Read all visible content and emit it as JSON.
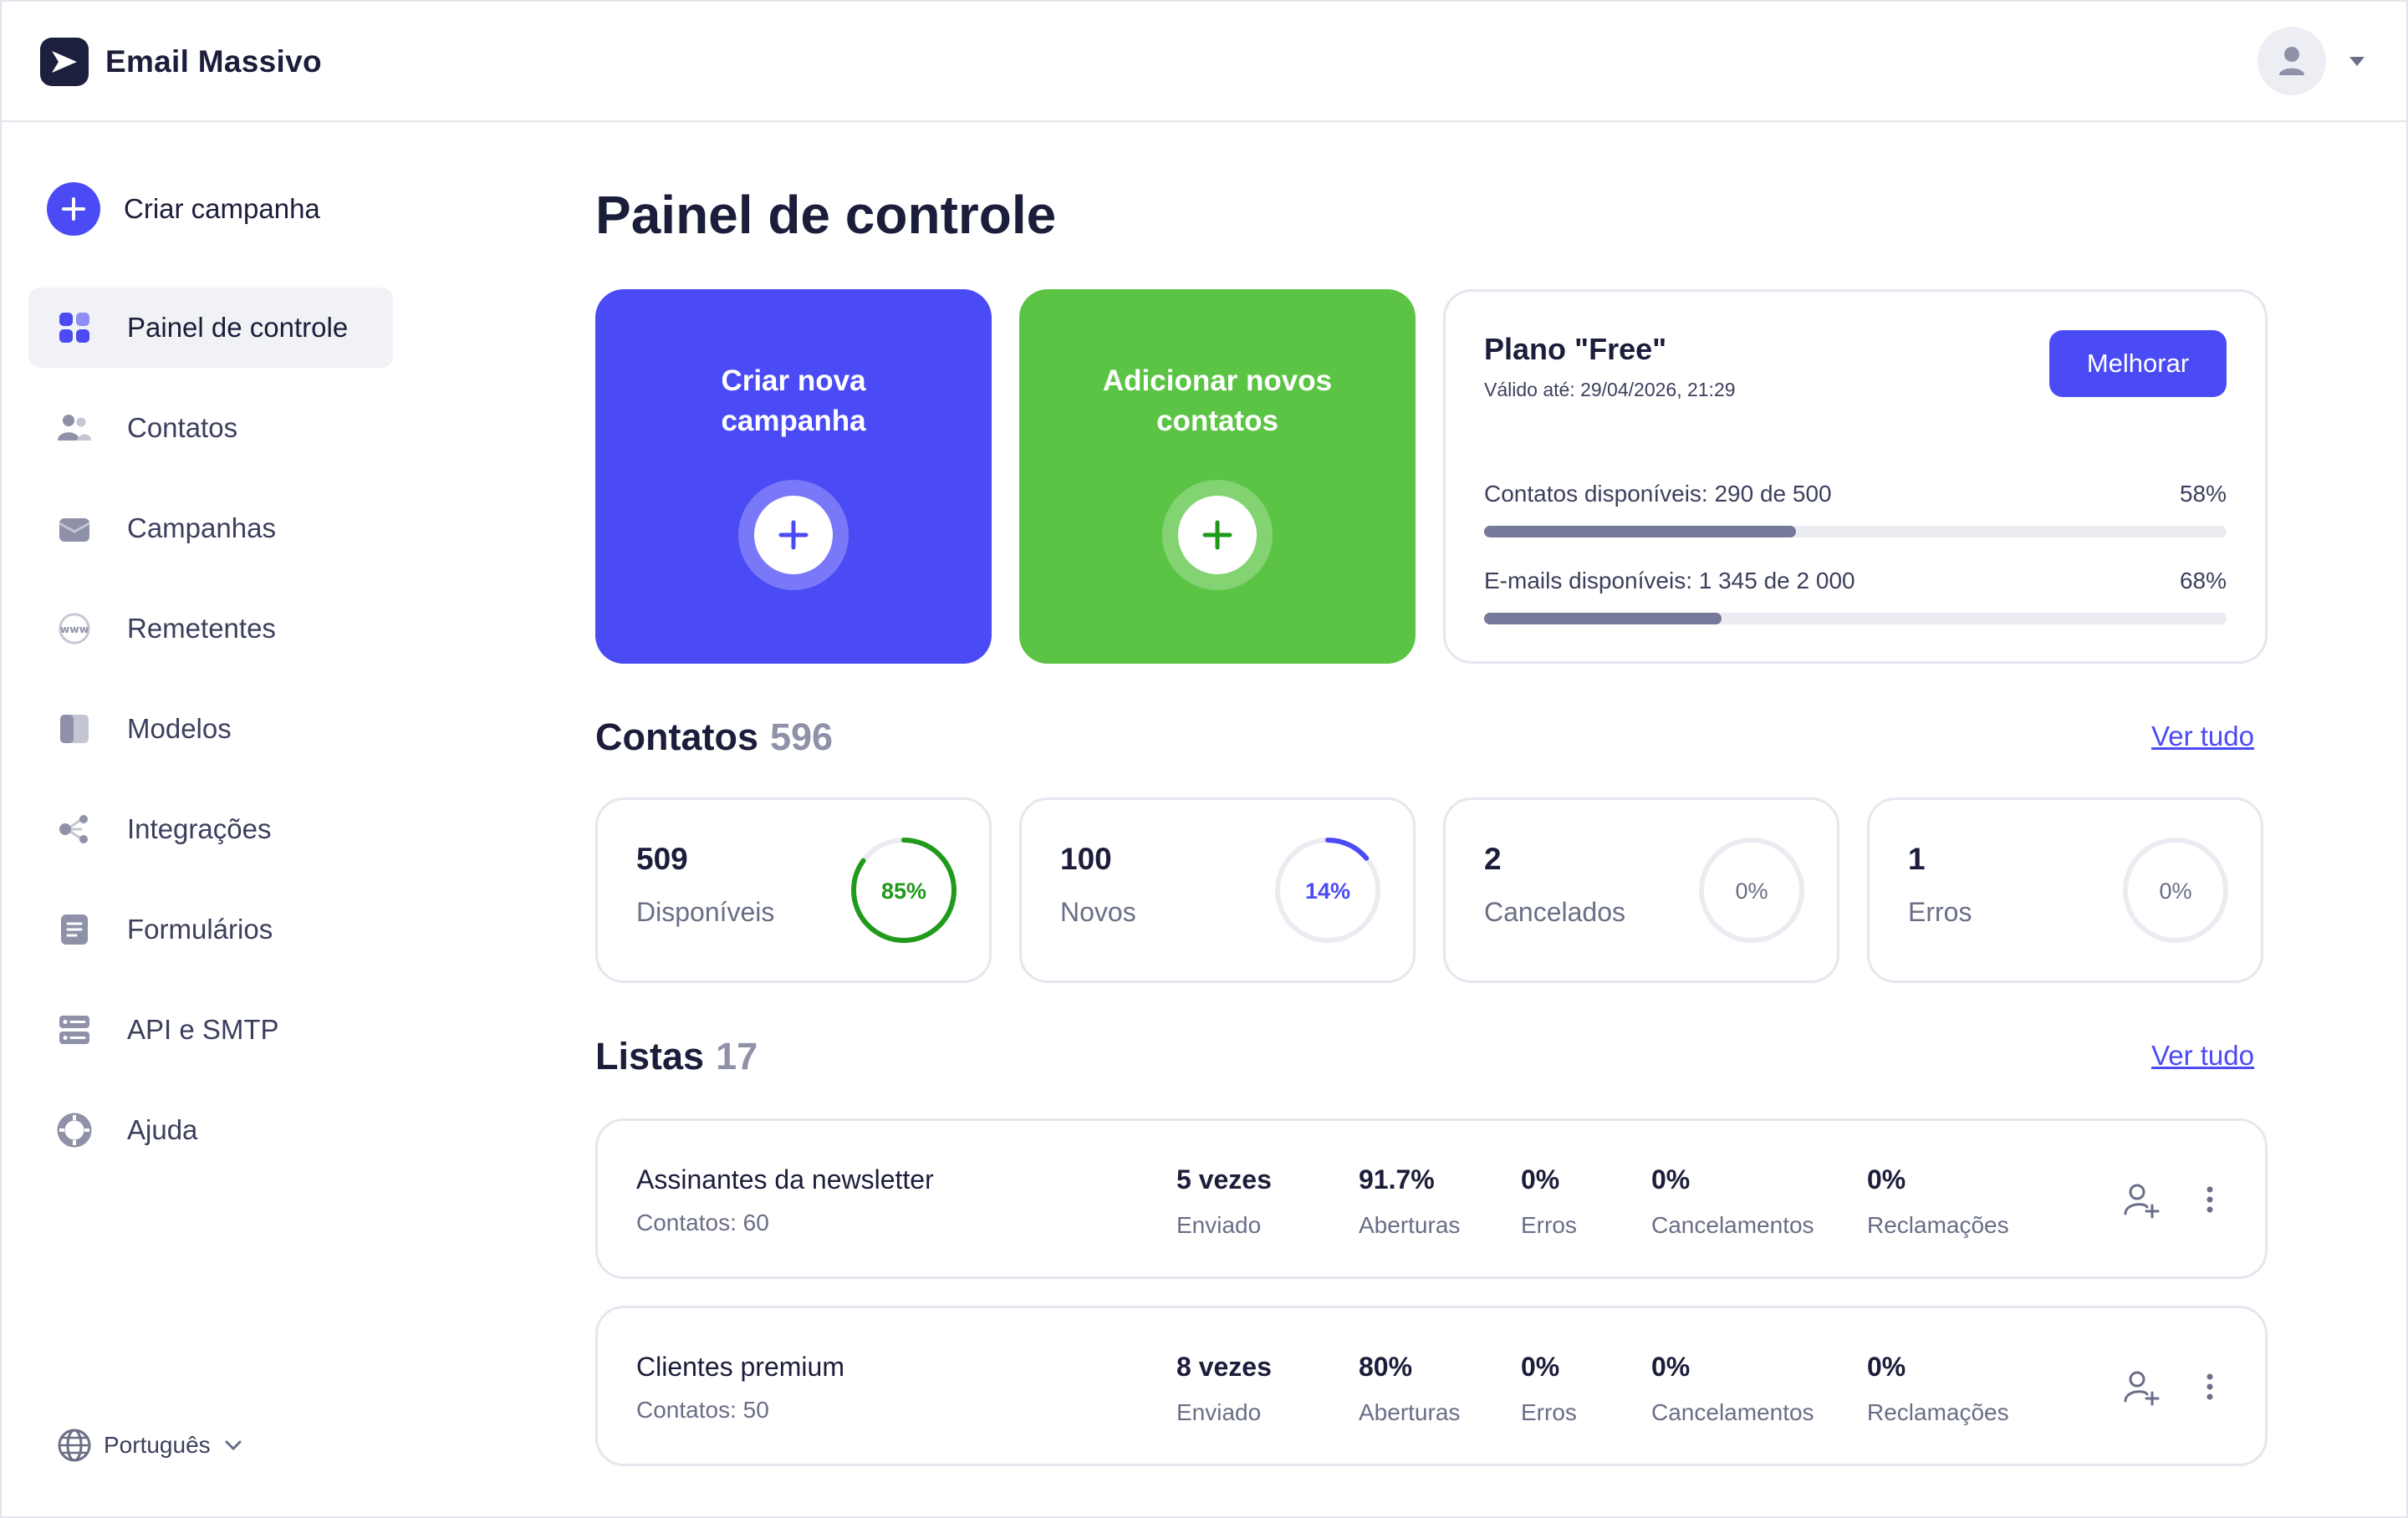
{
  "app": {
    "name": "Email Massivo"
  },
  "sidebar": {
    "create_label": "Criar campanha",
    "items": [
      {
        "label": "Painel de controle",
        "icon": "dashboard-icon",
        "active": true
      },
      {
        "label": "Contatos",
        "icon": "contacts-icon"
      },
      {
        "label": "Campanhas",
        "icon": "campaigns-icon"
      },
      {
        "label": "Remetentes",
        "icon": "senders-www-icon"
      },
      {
        "label": "Modelos",
        "icon": "templates-icon"
      },
      {
        "label": "Integrações",
        "icon": "integrations-icon"
      },
      {
        "label": "Formulários",
        "icon": "forms-icon"
      },
      {
        "label": "API e SMTP",
        "icon": "api-server-icon"
      },
      {
        "label": "Ajuda",
        "icon": "help-lifebuoy-icon"
      }
    ],
    "language": "Português"
  },
  "main": {
    "title": "Painel de controle",
    "actions": {
      "new_campaign": "Criar nova\ncampanha",
      "new_contacts": "Adicionar novos\ncontatos"
    },
    "plan": {
      "title": "Plano \"Free\"",
      "valid_until": "Válido até: 29/04/2026, 21:29",
      "upgrade_label": "Melhorar",
      "contacts_label": "Contatos disponíveis: 290 de 500",
      "contacts_pct_text": "58%",
      "contacts_fraction": 0.42,
      "emails_label": "E-mails disponíveis: 1 345 de 2 000",
      "emails_pct_text": "68%",
      "emails_fraction": 0.32
    },
    "contacts_section": {
      "title": "Contatos",
      "count": "596",
      "view_all": "Ver tudo",
      "stats": [
        {
          "value": "509",
          "label": "Disponíveis",
          "pct_text": "85%",
          "pct": 85,
          "color": "#1f9a1a"
        },
        {
          "value": "100",
          "label": "Novos",
          "pct_text": "14%",
          "pct": 14,
          "color": "#4b4bf6"
        },
        {
          "value": "2",
          "label": "Cancelados",
          "pct_text": "0%",
          "pct": 0,
          "color": "#6a6e86"
        },
        {
          "value": "1",
          "label": "Erros",
          "pct_text": "0%",
          "pct": 0,
          "color": "#6a6e86"
        }
      ]
    },
    "lists_section": {
      "title": "Listas",
      "count": "17",
      "view_all": "Ver tudo",
      "lists": [
        {
          "name": "Assinantes da newsletter",
          "contacts": "Contatos: 60",
          "sent": "5 vezes",
          "sent_label": "Enviado",
          "opens": "91.7%",
          "opens_label": "Aberturas",
          "errors": "0%",
          "errors_label": "Erros",
          "unsubs": "0%",
          "unsubs_label": "Cancelamentos",
          "complaints": "0%",
          "complaints_label": "Reclamações"
        },
        {
          "name": "Clientes premium",
          "contacts": "Contatos: 50",
          "sent": "8 vezes",
          "sent_label": "Enviado",
          "opens": "80%",
          "opens_label": "Aberturas",
          "errors": "0%",
          "errors_label": "Erros",
          "unsubs": "0%",
          "unsubs_label": "Cancelamentos",
          "complaints": "0%",
          "complaints_label": "Reclamações"
        }
      ]
    }
  },
  "colors": {
    "primary": "#4b4bf6",
    "success": "#5bc444",
    "text": "#1b1d3a",
    "muted": "#6a6e86"
  }
}
